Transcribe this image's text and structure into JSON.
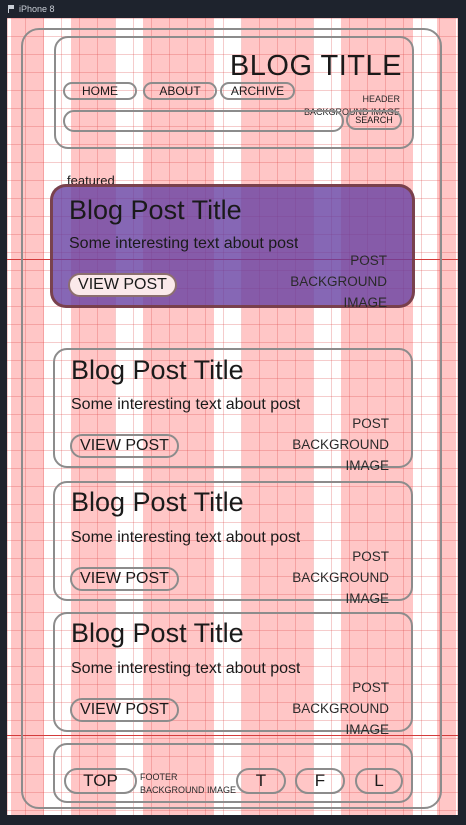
{
  "window": {
    "title": "iPhone 8"
  },
  "header": {
    "title": "BLOG TITLE",
    "note": "HEADER\nBACKGROUND IMAGE",
    "nav": [
      {
        "label": "HOME"
      },
      {
        "label": "ABOUT"
      },
      {
        "label": "ARCHIVE"
      }
    ],
    "search": {
      "value": "",
      "placeholder": "",
      "button_label": "SEARCH"
    }
  },
  "featured": {
    "label": "featured",
    "post": {
      "title": "Blog Post Title",
      "excerpt": "Some interesting text about post",
      "button_label": "VIEW POST",
      "note": "POST\nBACKGROUND\nIMAGE"
    }
  },
  "posts": [
    {
      "title": "Blog Post Title",
      "excerpt": "Some interesting text about post",
      "button_label": "VIEW POST",
      "note": "POST\nBACKGROUND\nIMAGE"
    },
    {
      "title": "Blog Post Title",
      "excerpt": "Some interesting text about post",
      "button_label": "VIEW POST",
      "note": "POST\nBACKGROUND\nIMAGE"
    },
    {
      "title": "Blog Post Title",
      "excerpt": "Some interesting text about post",
      "button_label": "VIEW POST",
      "note": "POST\nBACKGROUND\nIMAGE"
    }
  ],
  "footer": {
    "top_label": "TOP",
    "note": "FOOTER\nBACKGROUND IMAGE",
    "social": [
      {
        "label": "T"
      },
      {
        "label": "F"
      },
      {
        "label": "L"
      }
    ]
  },
  "colors": {
    "canvas": "#1e232d",
    "grid_column": "#ff6969",
    "guide_line": "#d43b3b",
    "outline": "#8c8c8c",
    "featured_fill": "#643ca0"
  }
}
